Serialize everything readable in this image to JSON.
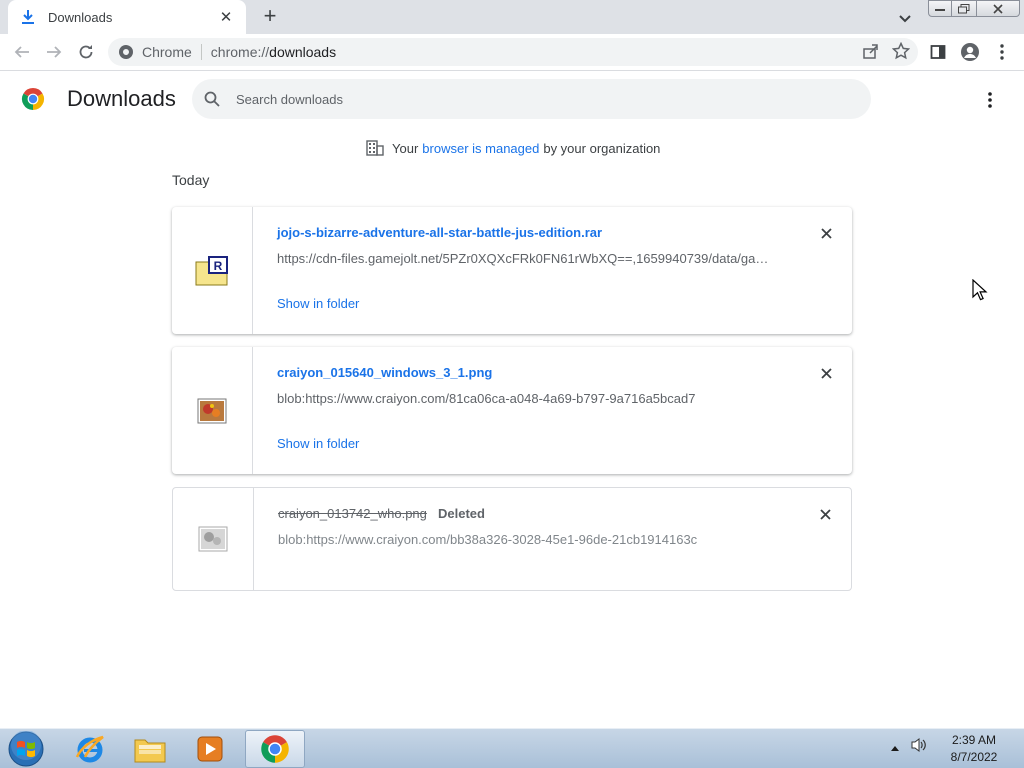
{
  "tab": {
    "title": "Downloads",
    "close": "✕",
    "new": "+"
  },
  "toolbar": {
    "site_chip": "Chrome",
    "url_prefix": "chrome://",
    "url_host": "downloads"
  },
  "header": {
    "title": "Downloads",
    "search_placeholder": "Search downloads"
  },
  "managed": {
    "before": "Your",
    "link": "browser is managed",
    "after": "by your organization"
  },
  "section_date": "Today",
  "downloads": [
    {
      "name": "jojo-s-bizarre-adventure-all-star-battle-jus-edition.rar",
      "url": "https://cdn-files.gamejolt.net/5PZr0XQXcFRk0FN61rWbXQ==,1659940739/data/ga…",
      "action": "Show in folder",
      "icon": "rar-file-icon"
    },
    {
      "name": "craiyon_015640_windows_3_1.png",
      "url": "blob:https://www.craiyon.com/81ca06ca-a048-4a69-b797-9a716a5bcad7",
      "action": "Show in folder",
      "icon": "png-file-icon"
    },
    {
      "name": "craiyon_013742_who.png",
      "status": "Deleted",
      "url": "blob:https://www.craiyon.com/bb38a326-3028-45e1-96de-21cb1914163c",
      "icon": "png-file-icon-grayed"
    }
  ],
  "taskbar": {
    "time": "2:39 AM",
    "date": "8/7/2022"
  },
  "colors": {
    "accent": "#1a73e8",
    "tabstrip": "#dee1e6",
    "taskbar": "#b4c8dd"
  }
}
